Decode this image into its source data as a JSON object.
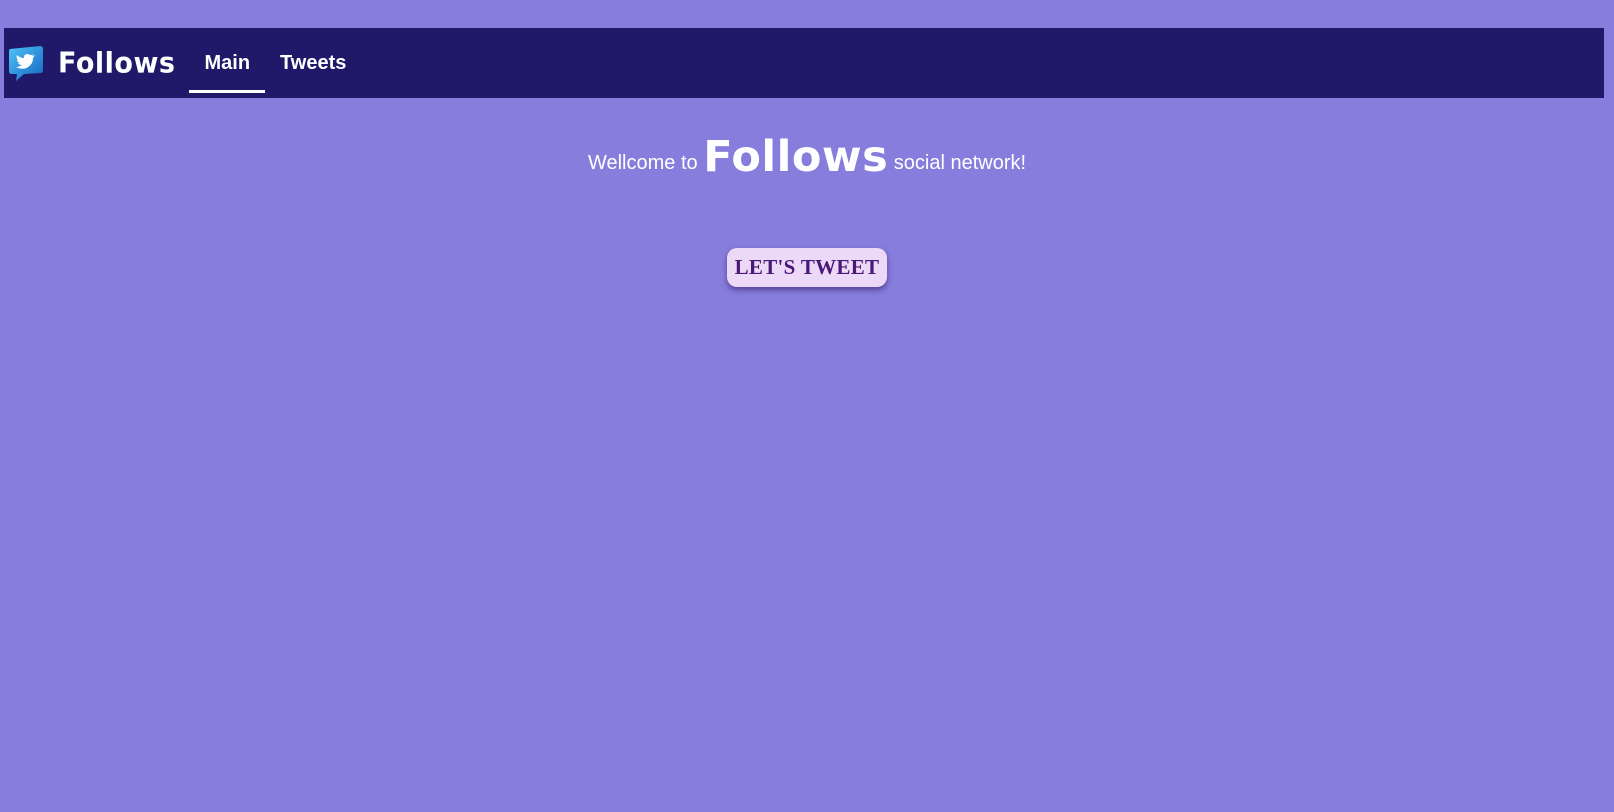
{
  "header": {
    "logo_icon": "twitter-bird-icon",
    "brand": "Follows",
    "tabs": [
      {
        "label": "Main",
        "active": true
      },
      {
        "label": "Tweets",
        "active": false
      }
    ]
  },
  "main": {
    "welcome_prefix": "Wellcome to",
    "welcome_brand": "Follows",
    "welcome_suffix": "social network!",
    "cta_label": "LET'S TWEET"
  },
  "colors": {
    "page_background": "#877ddc",
    "navbar_background": "#20196a",
    "button_background": "#ecd9f7",
    "button_text": "#4a1877",
    "logo_blue": "#1da1f2"
  }
}
